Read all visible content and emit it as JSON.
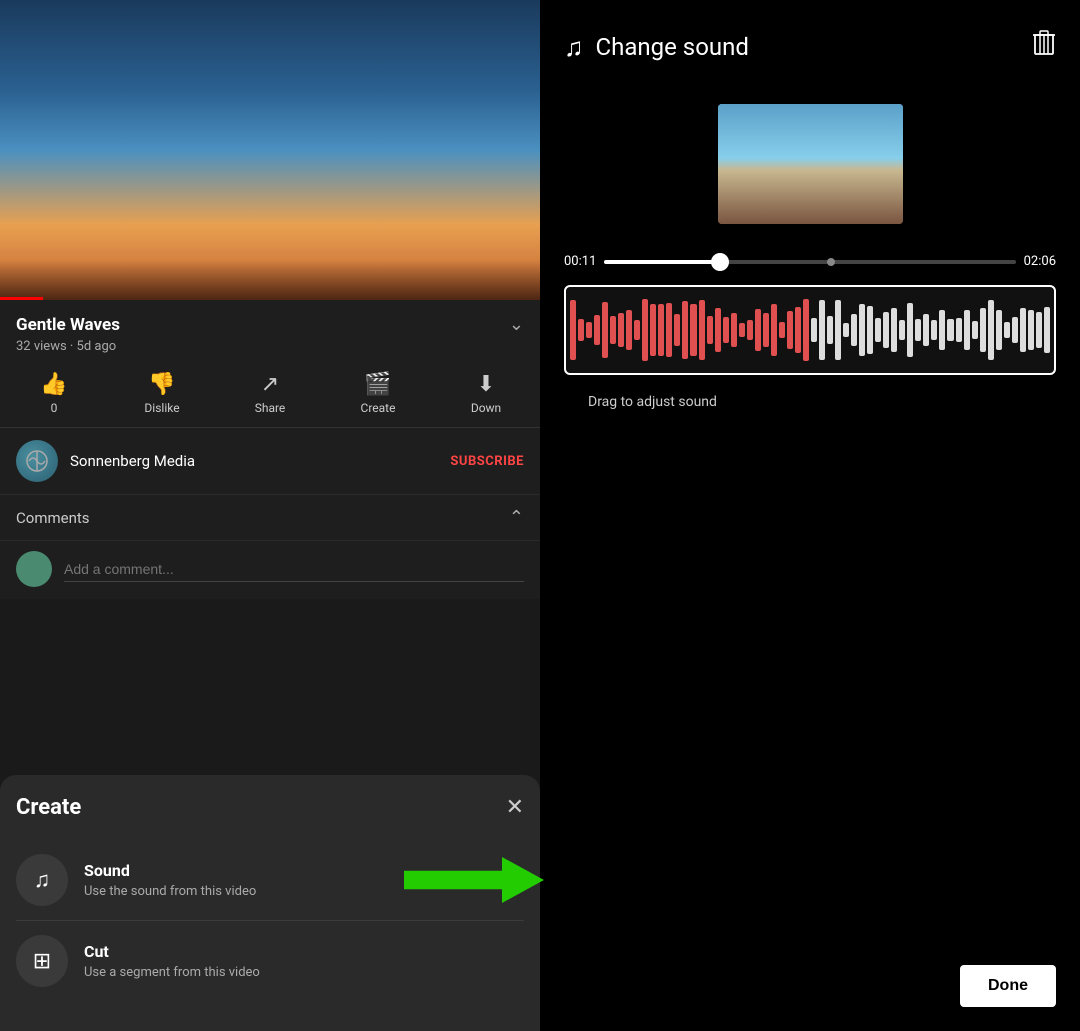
{
  "left": {
    "video": {
      "title": "Gentle Waves",
      "meta": "32 views · 5d ago",
      "progress_pct": 8
    },
    "actions": [
      {
        "icon": "👍",
        "label": "0",
        "name": "like"
      },
      {
        "icon": "👎",
        "label": "Dislike",
        "name": "dislike"
      },
      {
        "icon": "↗",
        "label": "Share",
        "name": "share"
      },
      {
        "icon": "🎬",
        "label": "Create",
        "name": "create"
      },
      {
        "icon": "⬇",
        "label": "Down",
        "name": "download"
      }
    ],
    "channel": {
      "name": "Sonnenberg Media",
      "subscribe_label": "SUBSCRIBE"
    },
    "comments": {
      "label": "Comments",
      "placeholder": "Add a comment..."
    },
    "create_panel": {
      "title": "Create",
      "close_icon": "✕",
      "items": [
        {
          "icon": "♫",
          "title": "Sound",
          "description": "Use the sound from this video",
          "name": "sound-item",
          "has_arrow": true
        },
        {
          "icon": "▦",
          "title": "Cut",
          "description": "Use a segment from this video",
          "name": "cut-item",
          "has_arrow": false
        }
      ]
    }
  },
  "right": {
    "header": {
      "music_icon": "♫",
      "title": "Change sound",
      "trash_icon": "🗑"
    },
    "timeline": {
      "current_time": "00:11",
      "end_time": "02:06"
    },
    "waveform": {
      "bar_count": 60,
      "split_point": 30
    },
    "drag_label": "Drag to adjust sound",
    "done_button": "Done"
  }
}
